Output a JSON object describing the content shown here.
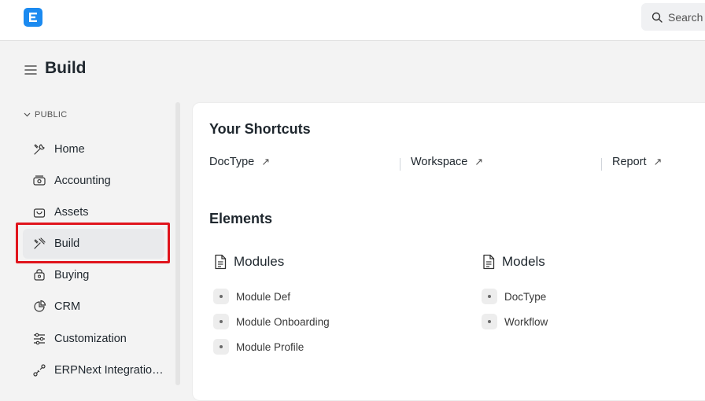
{
  "navbar": {
    "logo_letter": "E",
    "search_label": "Search"
  },
  "page": {
    "title": "Build"
  },
  "sidebar": {
    "section_label": "PUBLIC",
    "items": [
      {
        "label": "Home",
        "icon": "tools-icon"
      },
      {
        "label": "Accounting",
        "icon": "money-icon"
      },
      {
        "label": "Assets",
        "icon": "bag-icon"
      },
      {
        "label": "Build",
        "icon": "hammer-icon",
        "active": true
      },
      {
        "label": "Buying",
        "icon": "cart-icon"
      },
      {
        "label": "CRM",
        "icon": "pie-chart-icon"
      },
      {
        "label": "Customization",
        "icon": "sliders-icon"
      },
      {
        "label": "ERPNext Integratio…",
        "icon": "integration-icon"
      }
    ]
  },
  "main": {
    "shortcuts_heading": "Your Shortcuts",
    "shortcuts": [
      "DocType",
      "Workspace",
      "Report"
    ],
    "elements_heading": "Elements",
    "groups": [
      {
        "title": "Modules",
        "links": [
          "Module Def",
          "Module Onboarding",
          "Module Profile"
        ]
      },
      {
        "title": "Models",
        "links": [
          "DocType",
          "Workflow"
        ]
      }
    ]
  },
  "colors": {
    "brand": "#1b8af0",
    "highlight": "#e0141c",
    "active_bg": "#e9eaec"
  }
}
